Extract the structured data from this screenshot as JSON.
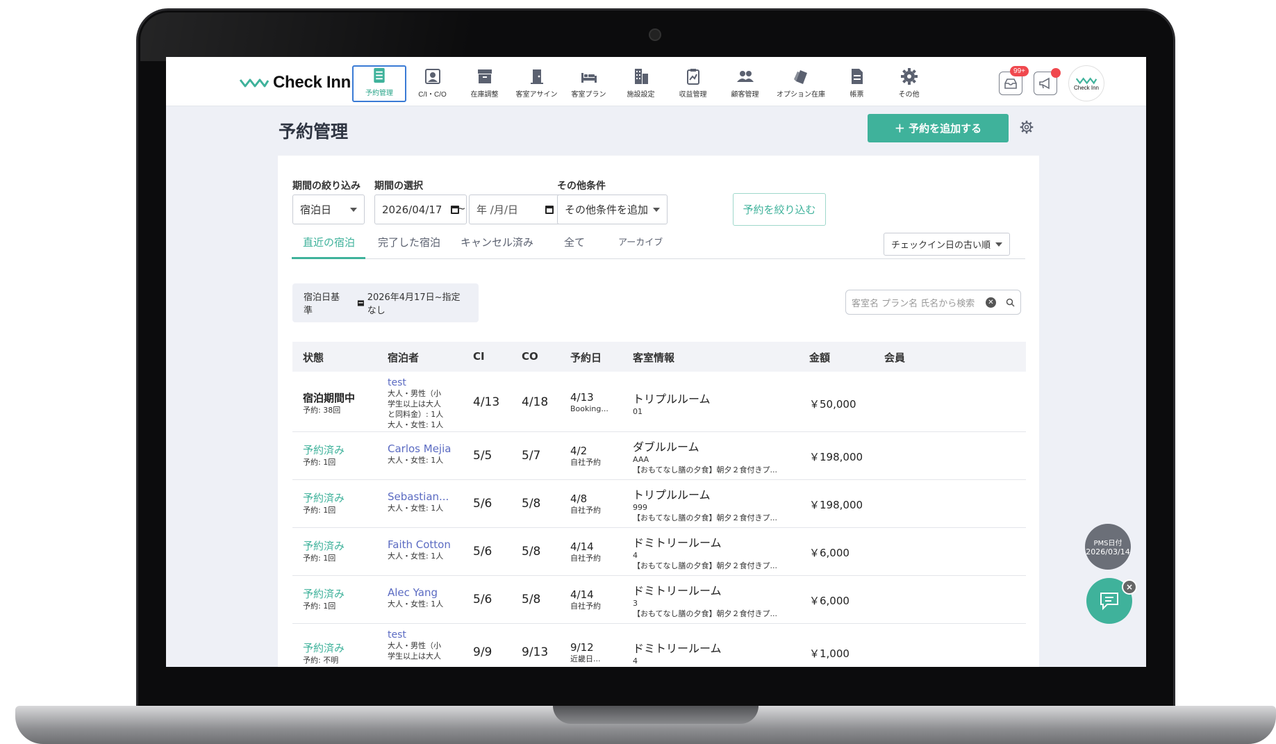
{
  "app": {
    "logo_text": "Check Inn",
    "avatar_text": "Check Inn"
  },
  "nav": {
    "items": [
      {
        "label": "予約管理",
        "icon": "list-icon",
        "active": true
      },
      {
        "label": "C/I・C/O",
        "icon": "person-card-icon",
        "active": false
      },
      {
        "label": "在庫調整",
        "icon": "archive-icon",
        "active": false
      },
      {
        "label": "客室アサイン",
        "icon": "door-icon",
        "active": false
      },
      {
        "label": "客室プラン",
        "icon": "bed-icon",
        "active": false
      },
      {
        "label": "施設設定",
        "icon": "building-icon",
        "active": false
      },
      {
        "label": "収益管理",
        "icon": "clipboard-chart-icon",
        "active": false
      },
      {
        "label": "顧客管理",
        "icon": "people-icon",
        "active": false
      },
      {
        "label": "オプション在庫",
        "icon": "tags-icon",
        "active": false
      },
      {
        "label": "帳票",
        "icon": "document-icon",
        "active": false
      },
      {
        "label": "その他",
        "icon": "gear-icon",
        "active": false
      }
    ],
    "inbox_badge": "99+"
  },
  "page": {
    "title": "予約管理",
    "add_button": "＋ 予約を追加する"
  },
  "filters": {
    "narrow_label": "期間の絞り込み",
    "narrow_value": "宿泊日",
    "period_label": "期間の選択",
    "date_from": "2026/04/17",
    "separator": "~",
    "date_to": "年 /月/日",
    "other_label": "その他条件",
    "other_value": "その他条件を追加",
    "apply_button": "予約を絞り込む"
  },
  "tabs": [
    "直近の宿泊",
    "完了した宿泊",
    "キャンセル済み",
    "全て",
    "アーカイブ"
  ],
  "sort": "チェックイン日の古い順",
  "chip": {
    "base": "宿泊日基準",
    "range": "2026年4月17日~指定なし"
  },
  "search": {
    "placeholder": "客室名 プラン名 氏名から検索",
    "clear": "✕"
  },
  "table": {
    "headers": [
      "状態",
      "宿泊者",
      "CI",
      "CO",
      "予約日",
      "客室情報",
      "金額",
      "会員"
    ],
    "rows": [
      {
        "status": "宿泊期間中",
        "count": "予約: 38回",
        "guest": "test",
        "guest_lines": [
          "大人・男性（小",
          "学生以上は大人",
          "と同料金）: 1人",
          "大人・女性: 1人"
        ],
        "ci": "4/13",
        "co": "4/18",
        "booked": "4/13",
        "source": "Booking...",
        "room": "トリプルルーム",
        "room_no": "01",
        "plan": "",
        "price": "￥50,000"
      },
      {
        "status": "予約済み",
        "count": "予約: 1回",
        "guest": "Carlos Mejia",
        "guest_lines": [
          "大人・女性: 1人"
        ],
        "ci": "5/5",
        "co": "5/7",
        "booked": "4/2",
        "source": "自社予約",
        "room": "ダブルルーム",
        "room_no": "AAA",
        "plan": "【おもてなし膳の夕食】朝夕２食付きプ...",
        "price": "￥198,000"
      },
      {
        "status": "予約済み",
        "count": "予約: 1回",
        "guest": "Sebastian...",
        "guest_lines": [
          "大人・女性: 1人"
        ],
        "ci": "5/6",
        "co": "5/8",
        "booked": "4/8",
        "source": "自社予約",
        "room": "トリプルルーム",
        "room_no": "999",
        "plan": "【おもてなし膳の夕食】朝夕２食付きプ...",
        "price": "￥198,000"
      },
      {
        "status": "予約済み",
        "count": "予約: 1回",
        "guest": "Faith Cotton",
        "guest_lines": [
          "大人・女性: 1人"
        ],
        "ci": "5/6",
        "co": "5/8",
        "booked": "4/14",
        "source": "自社予約",
        "room": "ドミトリールーム",
        "room_no": "4",
        "plan": "【おもてなし膳の夕食】朝夕２食付きプ...",
        "price": "￥6,000"
      },
      {
        "status": "予約済み",
        "count": "予約: 1回",
        "guest": "Alec Yang",
        "guest_lines": [
          "大人・女性: 1人"
        ],
        "ci": "5/6",
        "co": "5/8",
        "booked": "4/14",
        "source": "自社予約",
        "room": "ドミトリールーム",
        "room_no": "3",
        "plan": "【おもてなし膳の夕食】朝夕２食付きプ...",
        "price": "￥6,000"
      },
      {
        "status": "予約済み",
        "count": "予約: 不明",
        "guest": "test",
        "guest_lines": [
          "大人・男性（小",
          "学生以上は大人"
        ],
        "ci": "9/9",
        "co": "9/13",
        "booked": "9/12",
        "source": "近畿日...",
        "room": "ドミトリールーム",
        "room_no": "4",
        "plan": "",
        "price": "￥1,000"
      }
    ]
  },
  "pms": {
    "label": "PMS日付",
    "date": "2026/03/14"
  },
  "chat": {
    "close": "×"
  },
  "colors": {
    "accent": "#3fb29b",
    "link": "#5b6bc2",
    "badge": "#f0484e"
  }
}
